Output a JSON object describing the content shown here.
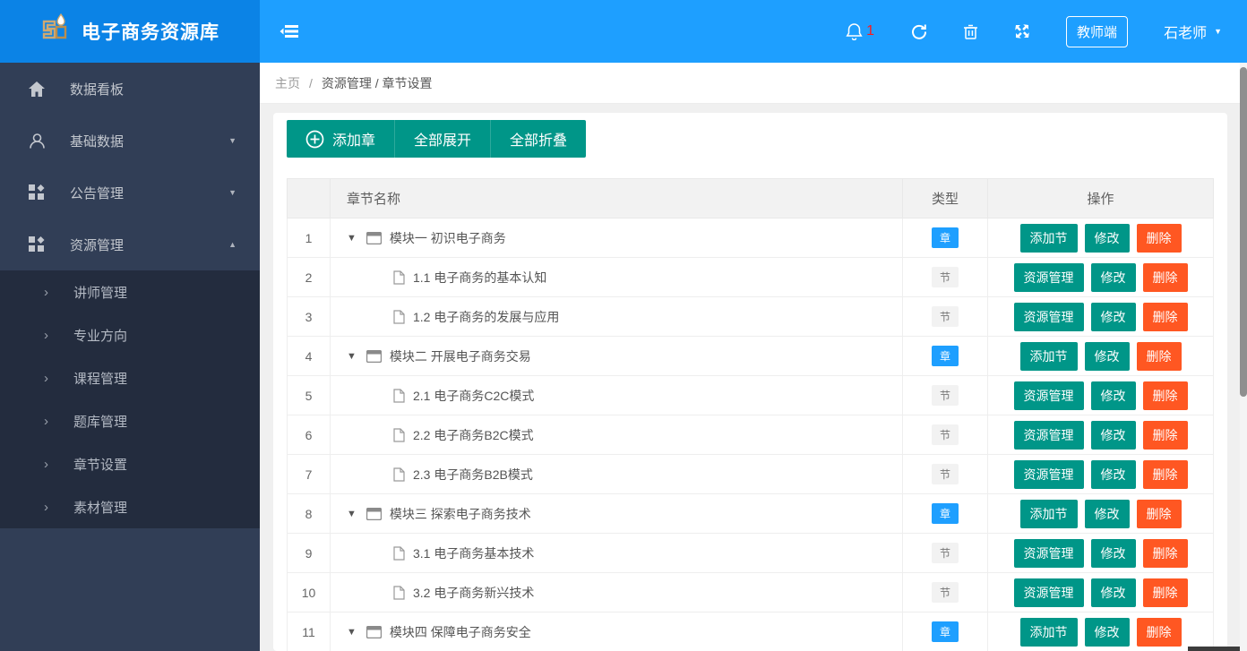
{
  "header": {
    "app_title": "电子商务资源库",
    "notification_count": "1",
    "teacher_button": "教师端",
    "user_name": "石老师"
  },
  "sidebar": {
    "items": [
      {
        "label": "数据看板",
        "icon": "home-icon",
        "caret": ""
      },
      {
        "label": "基础数据",
        "icon": "user-icon",
        "caret": "down"
      },
      {
        "label": "公告管理",
        "icon": "grid-icon",
        "caret": "down"
      },
      {
        "label": "资源管理",
        "icon": "grid-icon",
        "caret": "up"
      }
    ],
    "submenu": [
      "讲师管理",
      "专业方向",
      "课程管理",
      "题库管理",
      "章节设置",
      "素材管理"
    ]
  },
  "breadcrumb": {
    "home": "主页",
    "separator": "/",
    "trail": "资源管理 / 章节设置"
  },
  "toolbar": {
    "add_chapter": "添加章",
    "expand_all": "全部展开",
    "collapse_all": "全部折叠"
  },
  "table": {
    "headers": {
      "name": "章节名称",
      "type": "类型",
      "ops": "操作"
    },
    "type_labels": {
      "chapter": "章",
      "section": "节"
    },
    "chapter_actions": [
      "添加节",
      "修改",
      "删除"
    ],
    "section_actions": [
      "资源管理",
      "修改",
      "删除"
    ],
    "rows": [
      {
        "num": "1",
        "name": "模块一 初识电子商务",
        "type": "chapter"
      },
      {
        "num": "2",
        "name": "1.1 电子商务的基本认知",
        "type": "section"
      },
      {
        "num": "3",
        "name": "1.2 电子商务的发展与应用",
        "type": "section"
      },
      {
        "num": "4",
        "name": "模块二 开展电子商务交易",
        "type": "chapter"
      },
      {
        "num": "5",
        "name": "2.1 电子商务C2C模式",
        "type": "section"
      },
      {
        "num": "6",
        "name": "2.2 电子商务B2C模式",
        "type": "section"
      },
      {
        "num": "7",
        "name": "2.3 电子商务B2B模式",
        "type": "section"
      },
      {
        "num": "8",
        "name": "模块三 探索电子商务技术",
        "type": "chapter"
      },
      {
        "num": "9",
        "name": "3.1 电子商务基本技术",
        "type": "section"
      },
      {
        "num": "10",
        "name": "3.2 电子商务新兴技术",
        "type": "section"
      },
      {
        "num": "11",
        "name": "模块四 保障电子商务安全",
        "type": "chapter"
      }
    ]
  },
  "icons": {
    "caret_down": "▼",
    "caret_up": "▲",
    "chevron_right": "›",
    "dropdown_caret": "▼"
  },
  "colors": {
    "header_blue": "#1e9fff",
    "logo_blue": "#0b83e6",
    "sidebar_bg": "#313e56",
    "submenu_bg": "#232c3e",
    "teal": "#009688",
    "delete_orange": "#ff5722",
    "chapter_badge_blue": "#1e9fff"
  }
}
